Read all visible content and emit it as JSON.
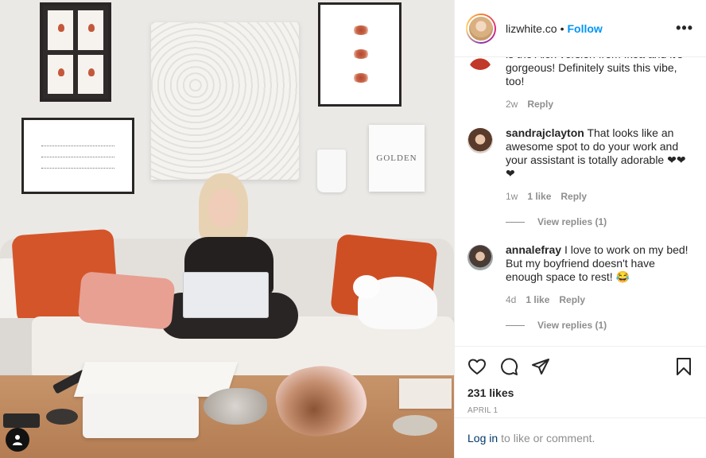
{
  "post": {
    "header": {
      "username": "lizwhite.co",
      "separator": "•",
      "follow_label": "Follow",
      "more_label": "•••"
    },
    "photo": {
      "sign_text": "GOLDEN",
      "user_tag_icon": "user-silhouette-icon"
    },
    "comments": [
      {
        "username": "",
        "text": "is the Alex version from Ikea and it's gorgeous! Definitely suits this vibe, too!",
        "time": "2w",
        "likes": "",
        "reply_label": "Reply"
      },
      {
        "username": "sandrajclayton",
        "text": "That looks like an awesome spot to do your work and your assistant is totally adorable ❤❤❤",
        "time": "1w",
        "likes": "1 like",
        "reply_label": "Reply",
        "view_replies": "View replies (1)"
      },
      {
        "username": "annalefray",
        "text": "I love to work on my bed! But my boyfriend doesn't have enough space to rest! 😂",
        "time": "4d",
        "likes": "1 like",
        "reply_label": "Reply",
        "view_replies": "View replies (1)"
      }
    ],
    "actions": {
      "like_icon": "heart-icon",
      "comment_icon": "comment-bubble-icon",
      "share_icon": "paper-plane-icon",
      "save_icon": "bookmark-icon"
    },
    "likes_count": "231 likes",
    "date": "APRIL 1",
    "login": {
      "link_label": "Log in",
      "rest": "to like or comment."
    }
  },
  "colors": {
    "link_blue": "#0095f6",
    "text": "#262626",
    "secondary": "#8e8e8e",
    "dark_link": "#00376b"
  }
}
